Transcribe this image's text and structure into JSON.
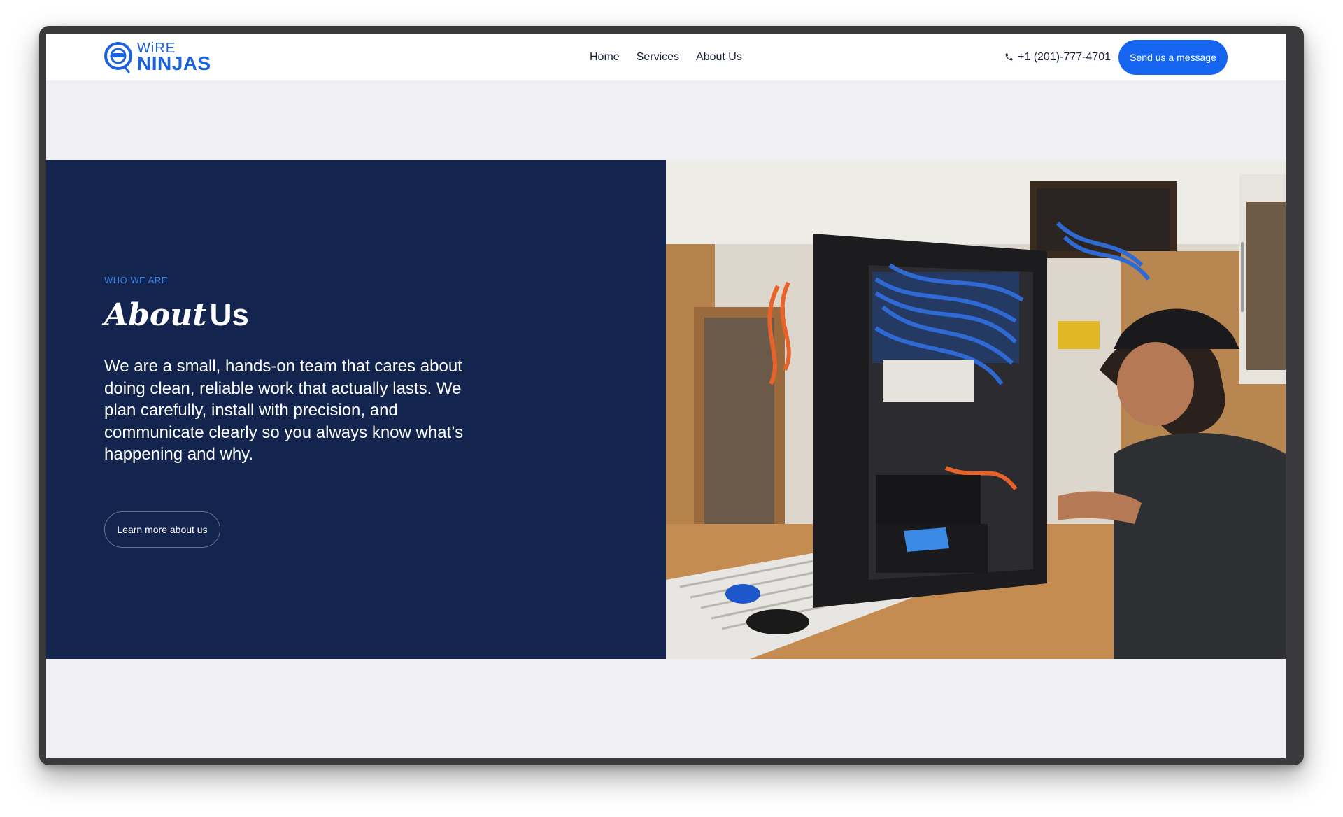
{
  "brand": {
    "name_top": "WiRE",
    "name_bottom": "NINJAS",
    "color": "#1b62e0"
  },
  "nav": {
    "items": [
      {
        "label": "Home"
      },
      {
        "label": "Services"
      },
      {
        "label": "About Us"
      }
    ]
  },
  "contact": {
    "phone_icon": "phone-icon",
    "phone": "+1 (201)-777-4701",
    "cta_label": "Send us a message",
    "cta_color": "#1565f0"
  },
  "about": {
    "eyebrow": "WHO WE ARE",
    "title_script": "About",
    "title_plain": "Us",
    "description": "We are a small, hands-on team that cares about doing clean, reliable work that actually lasts. We plan carefully, install with precision, and communicate clearly so you always know what’s happening and why.",
    "button_label": "Learn more about us",
    "panel_color": "#13244e",
    "eyebrow_color": "#3b82e8"
  }
}
